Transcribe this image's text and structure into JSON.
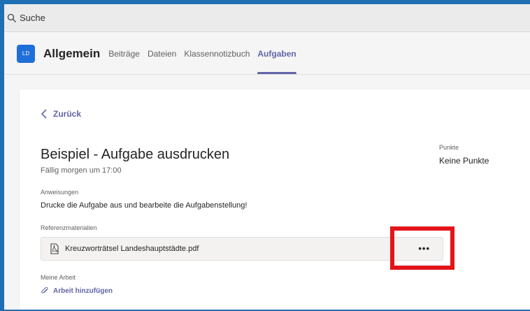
{
  "search": {
    "label": "Suche",
    "icon": "search-icon"
  },
  "channel": {
    "avatar_initials": "LD",
    "title": "Allgemein",
    "tabs": [
      {
        "label": "Beiträge"
      },
      {
        "label": "Dateien"
      },
      {
        "label": "Klassennotizbuch"
      },
      {
        "label": "Aufgaben",
        "active": true
      }
    ]
  },
  "assignment": {
    "back_label": "Zurück",
    "title": "Beispiel - Aufgabe ausdrucken",
    "due": "Fällig morgen um 17:00",
    "points_label": "Punkte",
    "points_value": "Keine Punkte",
    "instructions_label": "Anweisungen",
    "instructions_text": "Drucke die Aufgabe aus und bearbeite die Aufgabenstellung!",
    "reference_label": "Referenzmaterialien",
    "file_name": "Kreuzworträtsel Landeshauptstädte.pdf",
    "more_label": "•••",
    "my_work_label": "Meine Arbeit",
    "add_work_label": "Arbeit hinzufügen"
  },
  "colors": {
    "accent": "#6264a7",
    "frame": "#1f6fb5",
    "highlight": "#e3151a",
    "avatar": "#1f6fd9"
  }
}
